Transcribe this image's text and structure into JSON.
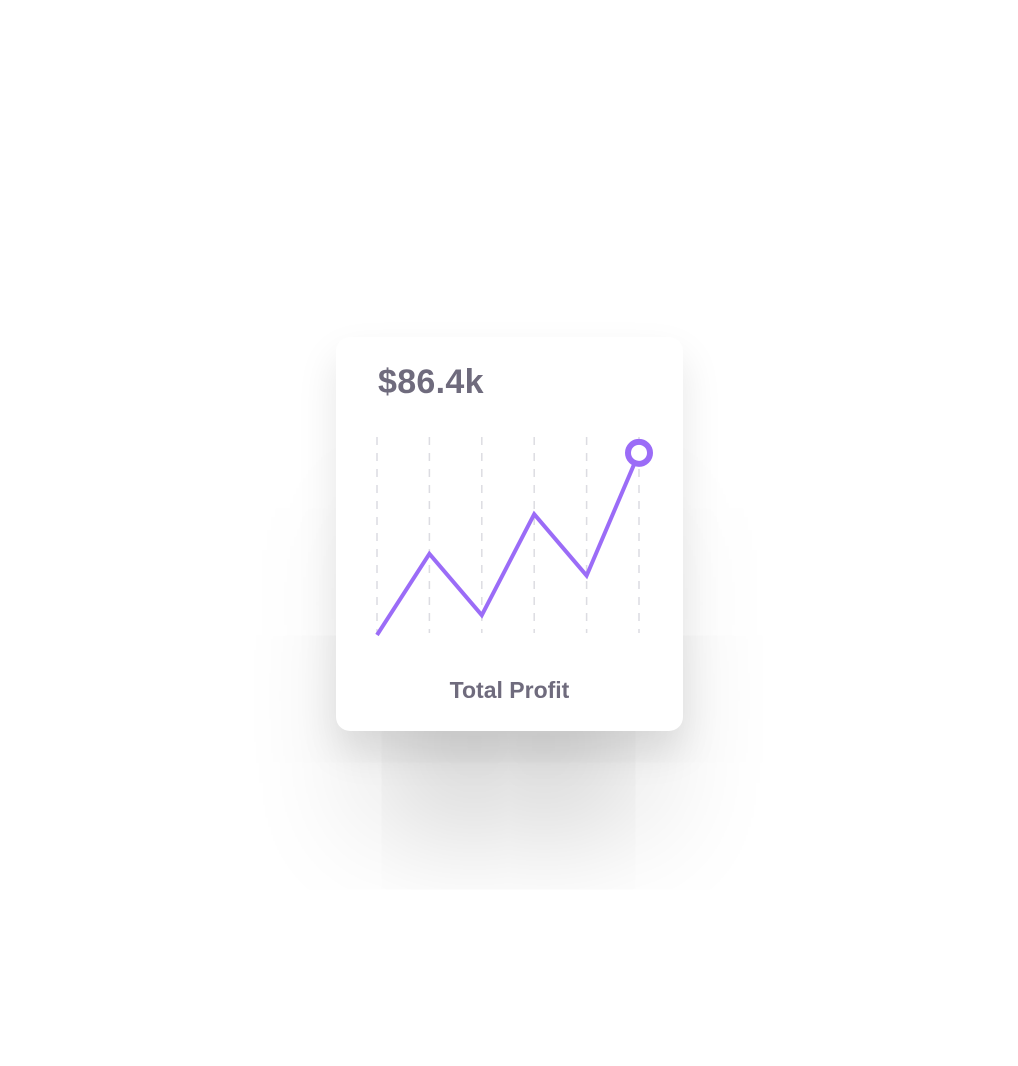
{
  "card": {
    "value": "$86.4k",
    "label": "Total Profit"
  },
  "colors": {
    "accent": "#9b6cf7",
    "text": "#6f6b7d",
    "grid": "#dcdce2"
  },
  "chart_data": {
    "type": "line",
    "x": [
      1,
      2,
      3,
      4,
      5,
      6
    ],
    "series": [
      {
        "values": [
          0,
          41,
          10,
          61,
          30,
          92
        ]
      }
    ],
    "ylim": [
      0,
      100
    ],
    "grid": "vertical-dashed",
    "highlight": "last-point"
  }
}
